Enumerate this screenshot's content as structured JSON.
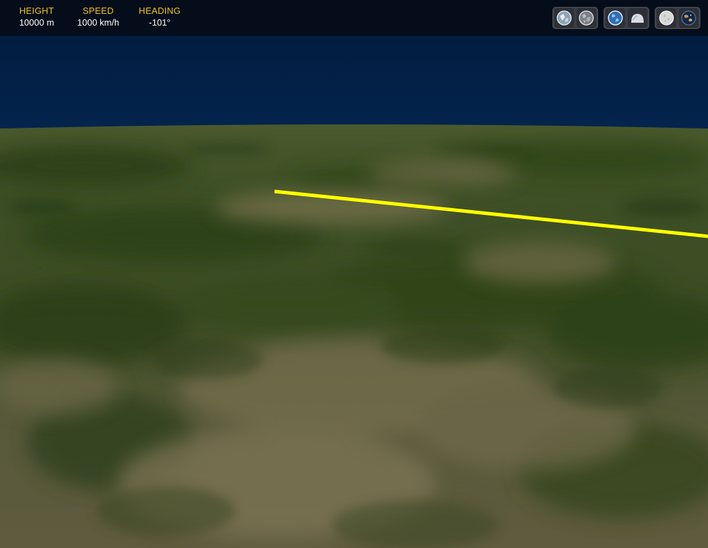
{
  "hud": {
    "height": {
      "label": "HEIGHT",
      "value": "10000 m"
    },
    "speed": {
      "label": "SPEED",
      "value": "1000 km/h"
    },
    "heading": {
      "label": "HEADING",
      "value": "-101°"
    }
  },
  "controls": {
    "groups": [
      {
        "buttons": [
          "map-view-icon",
          "satellite-view-icon"
        ]
      },
      {
        "buttons": [
          "globe-view-icon",
          "dome-view-icon"
        ]
      },
      {
        "buttons": [
          "moon-icon",
          "earth-night-icon"
        ]
      }
    ]
  },
  "scene": {
    "flight_path_color": "#ffff00",
    "sky_color": "#03224a",
    "terrain_color": "#4a5a2a"
  }
}
